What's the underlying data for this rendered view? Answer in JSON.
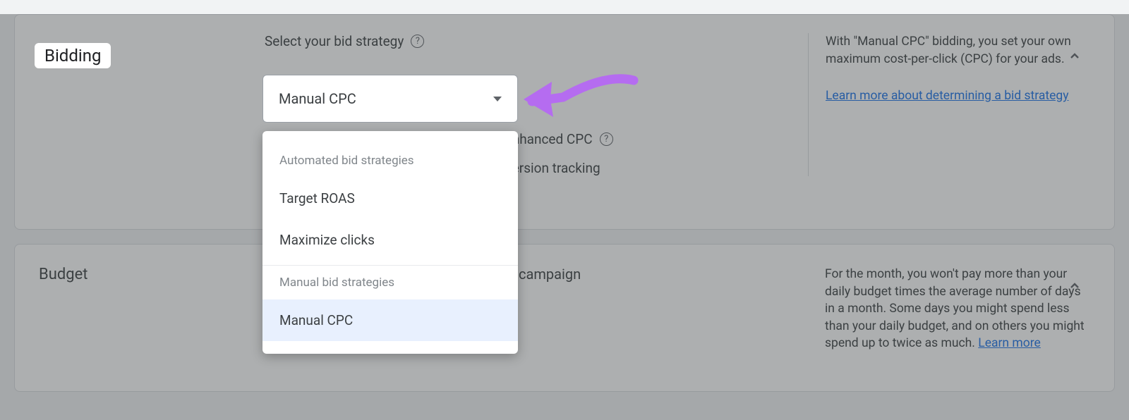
{
  "bidding": {
    "title": "Bidding",
    "field_label": "Select your bid strategy",
    "selected": "Manual CPC",
    "enhanced_label": "nhanced CPC",
    "tracking_label": "ersion tracking",
    "info_text": "With \"Manual CPC\" bidding, you set your own maximum cost-per-click (CPC) for your ads.",
    "learn_link": "Learn more about determining a bid strategy"
  },
  "dropdown": {
    "group1_label": "Automated bid strategies",
    "group1_items": [
      "Target ROAS",
      "Maximize clicks"
    ],
    "group2_label": "Manual bid strategies",
    "group2_items": [
      "Manual CPC"
    ]
  },
  "budget": {
    "title": "Budget",
    "mid_text": "campaign",
    "info_text": "For the month, you won't pay more than your daily budget times the average number of days in a month. Some days you might spend less than your daily budget, and on others you might spend up to twice as much. ",
    "learn_link": "Learn more"
  }
}
